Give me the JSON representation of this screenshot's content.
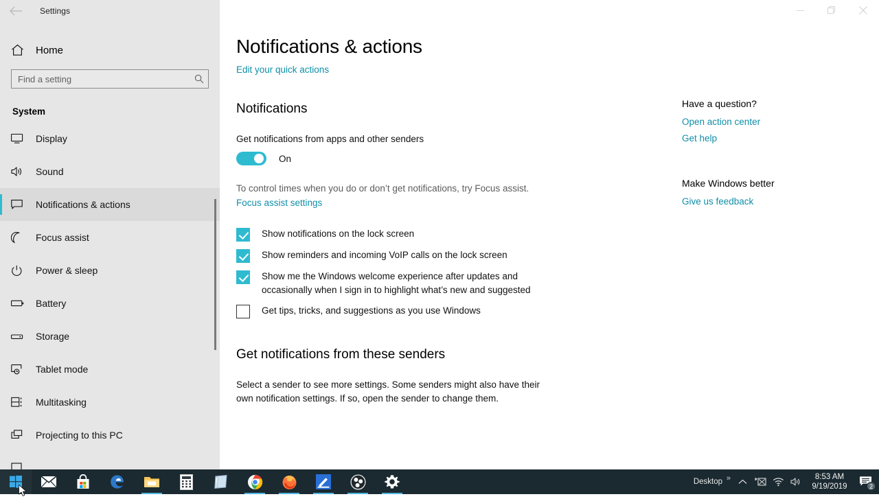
{
  "window": {
    "app_title": "Settings",
    "back_icon": "back-arrow-icon",
    "controls": {
      "minimize": "minimize-icon",
      "restore": "restore-icon",
      "close": "close-icon"
    }
  },
  "sidebar": {
    "home": {
      "label": "Home",
      "icon": "home-icon"
    },
    "search": {
      "placeholder": "Find a setting",
      "value": "",
      "icon": "search-icon"
    },
    "group_title": "System",
    "items": [
      {
        "label": "Display",
        "icon": "monitor-icon",
        "selected": false
      },
      {
        "label": "Sound",
        "icon": "speaker-icon",
        "selected": false
      },
      {
        "label": "Notifications & actions",
        "icon": "notification-icon",
        "selected": true
      },
      {
        "label": "Focus assist",
        "icon": "moon-icon",
        "selected": false
      },
      {
        "label": "Power & sleep",
        "icon": "power-icon",
        "selected": false
      },
      {
        "label": "Battery",
        "icon": "battery-icon",
        "selected": false
      },
      {
        "label": "Storage",
        "icon": "drive-icon",
        "selected": false
      },
      {
        "label": "Tablet mode",
        "icon": "tablet-icon",
        "selected": false
      },
      {
        "label": "Multitasking",
        "icon": "multitasking-icon",
        "selected": false
      },
      {
        "label": "Projecting to this PC",
        "icon": "projecting-icon",
        "selected": false
      }
    ]
  },
  "main": {
    "page_title": "Notifications & actions",
    "quick_actions_link": "Edit your quick actions",
    "notifications_heading": "Notifications",
    "toggle": {
      "label": "Get notifications from apps and other senders",
      "state": "On",
      "on": true
    },
    "focus_hint": "To control times when you do or don’t get notifications, try Focus assist.",
    "focus_link": "Focus assist settings",
    "checkboxes": [
      {
        "label": "Show notifications on the lock screen",
        "checked": true
      },
      {
        "label": "Show reminders and incoming VoIP calls on the lock screen",
        "checked": true
      },
      {
        "label": "Show me the Windows welcome experience after updates and occasionally when I sign in to highlight what’s new and suggested",
        "checked": true
      },
      {
        "label": "Get tips, tricks, and suggestions as you use Windows",
        "checked": false
      }
    ],
    "senders_heading": "Get notifications from these senders",
    "senders_text": "Select a sender to see more settings. Some senders might also have their own notification settings. If so, open the sender to change them."
  },
  "help_rail": {
    "question_heading": "Have a question?",
    "question_links": [
      "Open action center",
      "Get help"
    ],
    "feedback_heading": "Make Windows better",
    "feedback_link": "Give us feedback"
  },
  "taskbar": {
    "start": "windows-start-icon",
    "apps": [
      {
        "name": "mail-icon",
        "active": false
      },
      {
        "name": "store-icon",
        "active": false
      },
      {
        "name": "edge-icon",
        "active": false
      },
      {
        "name": "file-explorer-icon",
        "active": true
      },
      {
        "name": "calculator-icon",
        "active": false
      },
      {
        "name": "sticky-notes-icon",
        "active": false
      },
      {
        "name": "chrome-icon",
        "active": true
      },
      {
        "name": "firefox-icon",
        "active": true
      },
      {
        "name": "snip-sketch-icon",
        "active": true
      },
      {
        "name": "obs-studio-icon",
        "active": true
      },
      {
        "name": "settings-gear-icon",
        "active": true
      }
    ],
    "tray": {
      "desktop_label": "Desktop",
      "overflow_icon": "chevron-up-icon",
      "icons": [
        "pen-workspace-icon",
        "wifi-icon",
        "volume-icon"
      ],
      "time": "8:53 AM",
      "date": "9/19/2019",
      "action_center_icon": "action-center-icon",
      "notification_count": "2"
    }
  },
  "colors": {
    "accent": "#2ebbd0",
    "link": "#0f8ea8",
    "sidebar_bg": "#e6e6e6",
    "taskbar_bg": "#1b2a31"
  }
}
